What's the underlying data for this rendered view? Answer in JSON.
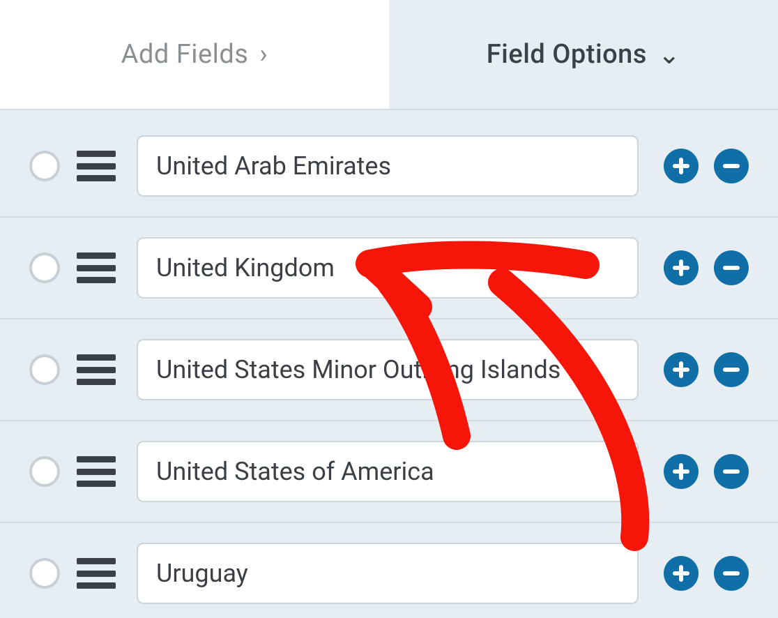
{
  "tabs": {
    "add_fields": {
      "label": "Add Fields",
      "chevron": "›"
    },
    "field_options": {
      "label": "Field Options",
      "chevron": "⌄"
    }
  },
  "choices": [
    {
      "value": "United Arab Emirates"
    },
    {
      "value": "United Kingdom"
    },
    {
      "value": "United States Minor Outlying Islands"
    },
    {
      "value": "United States of America"
    },
    {
      "value": "Uruguay"
    }
  ],
  "colors": {
    "accent": "#0f6fa6",
    "annotation": "#f61609"
  }
}
